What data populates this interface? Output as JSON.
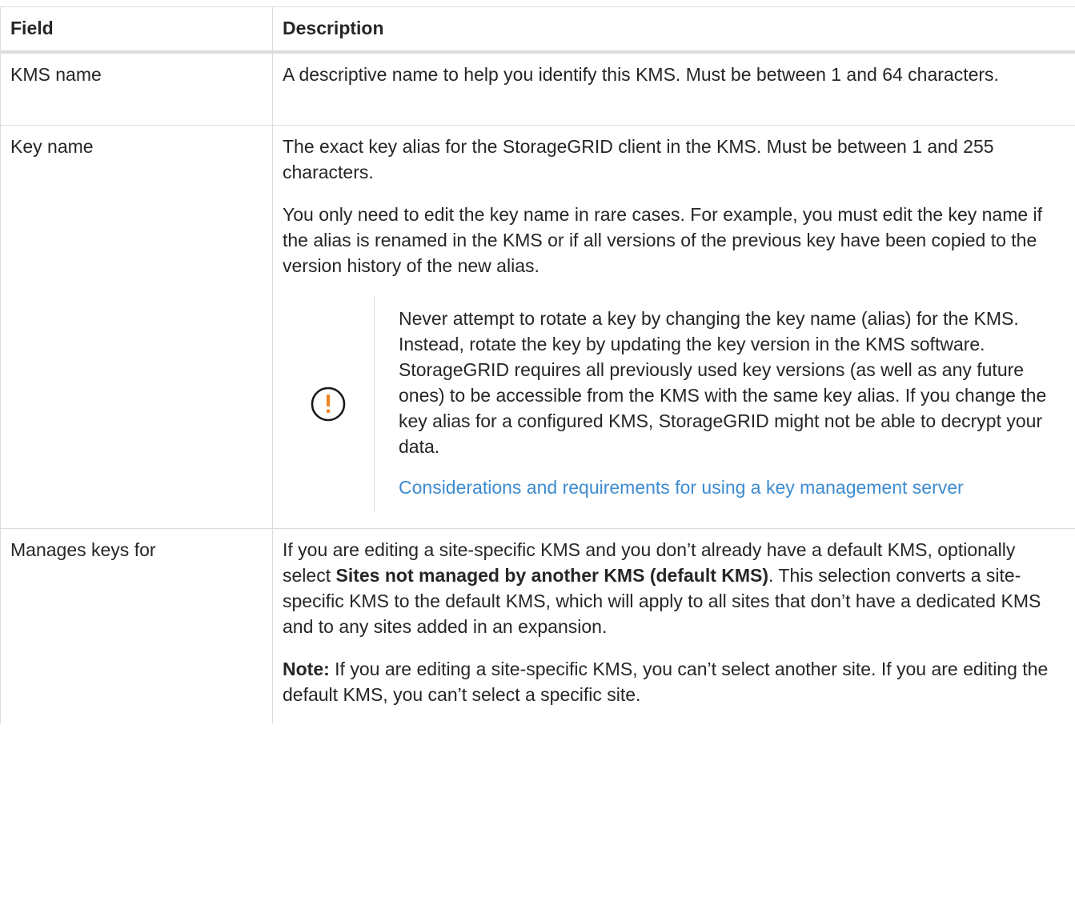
{
  "table": {
    "headers": {
      "field": "Field",
      "description": "Description"
    },
    "rows": {
      "kms_name": {
        "field": "KMS name",
        "description": "A descriptive name to help you identify this KMS. Must be between 1 and 64 characters."
      },
      "key_name": {
        "field": "Key name",
        "description_p1": "The exact key alias for the StorageGRID client in the KMS. Must be between 1 and 255 characters.",
        "description_p2": "You only need to edit the key name in rare cases. For example, you must edit the key name if the alias is renamed in the KMS or if all versions of the previous key have been copied to the version history of the new alias.",
        "caution": {
          "icon": "exclamation-circle-icon",
          "icon_color": "#f0841b",
          "text": "Never attempt to rotate a key by changing the key name (alias) for the KMS. Instead, rotate the key by updating the key version in the KMS software. StorageGRID requires all previously used key versions (as well as any future ones) to be accessible from the KMS with the same key alias. If you change the key alias for a configured KMS, StorageGRID might not be able to decrypt your data.",
          "link_text": "Considerations and requirements for using a key management server",
          "link_color": "#3d8bd0"
        }
      },
      "manages_keys": {
        "field": "Manages keys for",
        "p1_before": "If you are editing a site-specific KMS and you don’t already have a default KMS, optionally select ",
        "p1_bold": "Sites not managed by another KMS (default KMS)",
        "p1_after": ". This selection converts a site-specific KMS to the default KMS, which will apply to all sites that don’t have a dedicated KMS and to any sites added in an expansion.",
        "note_label": "Note:",
        "note_text": " If you are editing a site-specific KMS, you can’t select another site. If you are editing the default KMS, you can’t select a specific site."
      }
    }
  }
}
